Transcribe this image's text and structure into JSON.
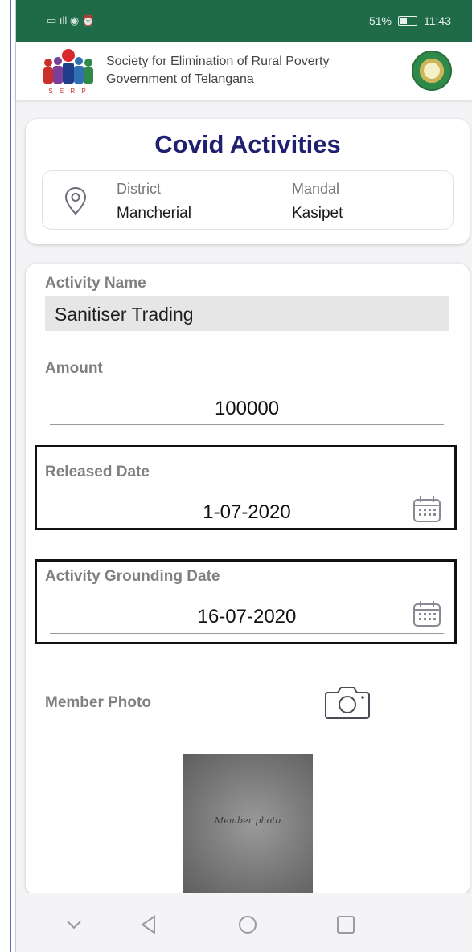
{
  "status_bar": {
    "left_glyphs": "▭ ıll ◉ ⏰",
    "battery": "51%",
    "battery_level": 0.51,
    "time": "11:43"
  },
  "header": {
    "org_line1": "Society for Elimination of Rural Poverty",
    "org_line2": "Government of Telangana",
    "logo_letters": "S E R P"
  },
  "location_card": {
    "title": "Covid Activities",
    "district_label": "District",
    "district_value": "Mancherial",
    "mandal_label": "Mandal",
    "mandal_value": "Kasipet"
  },
  "form": {
    "activity_name_label": "Activity Name",
    "activity_name_value": "Sanitiser Trading",
    "amount_label": "Amount",
    "amount_value": "100000",
    "released_date_label": "Released Date",
    "released_date_value": "1-07-2020",
    "grounding_date_label": "Activity Grounding Date",
    "grounding_date_value": "16-07-2020",
    "member_photo_label": "Member Photo",
    "photo_caption": "Member photo"
  },
  "colors": {
    "status_bar": "#1f6b47",
    "title": "#202070",
    "label": "#808080"
  },
  "icons": {
    "location": "map-pin-icon",
    "calendar": "calendar-icon",
    "camera": "camera-icon"
  }
}
